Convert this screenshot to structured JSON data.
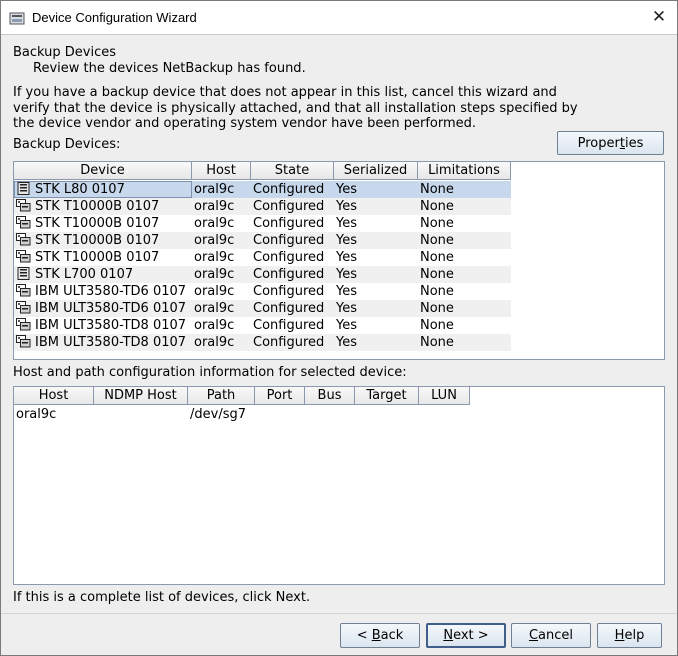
{
  "window": {
    "title": "Device Configuration Wizard",
    "close_glyph": "✕"
  },
  "header": {
    "section_title": "Backup Devices",
    "section_subtitle": "Review the devices NetBackup has found."
  },
  "instructions": {
    "line1": "If you have a backup device that does not appear in this list, cancel this wizard and",
    "line2": "verify that the device is physically attached, and that all installation steps specified by",
    "line3": "the device vendor and operating system vendor have been performed."
  },
  "devices_table": {
    "label": "Backup Devices:",
    "properties_button": {
      "pre": "Proper",
      "accel": "t",
      "post": "ies"
    },
    "columns": [
      "Device",
      "Host",
      "State",
      "Serialized",
      "Limitations"
    ],
    "rows": [
      {
        "icon": "robot-library-icon",
        "device": "STK L80 0107",
        "host": "oral9c",
        "state": "Configured",
        "serialized": "Yes",
        "limitations": "None",
        "selected": true
      },
      {
        "icon": "tape-drive-icon",
        "device": "STK T10000B 0107",
        "host": "oral9c",
        "state": "Configured",
        "serialized": "Yes",
        "limitations": "None"
      },
      {
        "icon": "tape-drive-icon",
        "device": "STK T10000B 0107",
        "host": "oral9c",
        "state": "Configured",
        "serialized": "Yes",
        "limitations": "None"
      },
      {
        "icon": "tape-drive-icon",
        "device": "STK T10000B 0107",
        "host": "oral9c",
        "state": "Configured",
        "serialized": "Yes",
        "limitations": "None"
      },
      {
        "icon": "tape-drive-icon",
        "device": "STK T10000B 0107",
        "host": "oral9c",
        "state": "Configured",
        "serialized": "Yes",
        "limitations": "None"
      },
      {
        "icon": "robot-library-icon",
        "device": "STK L700 0107",
        "host": "oral9c",
        "state": "Configured",
        "serialized": "Yes",
        "limitations": "None"
      },
      {
        "icon": "tape-drive-icon",
        "device": "IBM ULT3580-TD6 0107",
        "host": "oral9c",
        "state": "Configured",
        "serialized": "Yes",
        "limitations": "None"
      },
      {
        "icon": "tape-drive-icon",
        "device": "IBM ULT3580-TD6 0107",
        "host": "oral9c",
        "state": "Configured",
        "serialized": "Yes",
        "limitations": "None"
      },
      {
        "icon": "tape-drive-icon",
        "device": "IBM ULT3580-TD8 0107",
        "host": "oral9c",
        "state": "Configured",
        "serialized": "Yes",
        "limitations": "None"
      },
      {
        "icon": "tape-drive-icon",
        "device": "IBM ULT3580-TD8 0107",
        "host": "oral9c",
        "state": "Configured",
        "serialized": "Yes",
        "limitations": "None"
      }
    ]
  },
  "path_table": {
    "label": "Host and path configuration information for selected device:",
    "columns": [
      "Host",
      "NDMP Host",
      "Path",
      "Port",
      "Bus",
      "Target",
      "LUN"
    ],
    "rows": [
      {
        "host": "oral9c",
        "ndmp_host": "",
        "path": "/dev/sg7",
        "port": "",
        "bus": "",
        "target": "",
        "lun": ""
      }
    ]
  },
  "footer": {
    "hint": "If this is a complete list of devices, click Next."
  },
  "buttons": {
    "back": {
      "pre": "< ",
      "accel": "B",
      "post": "ack"
    },
    "next": {
      "pre": "",
      "accel": "N",
      "post": "ext >"
    },
    "cancel": {
      "pre": "",
      "accel": "C",
      "post": "ancel"
    },
    "help": {
      "pre": "",
      "accel": "H",
      "post": "elp"
    }
  },
  "colors": {
    "selection": "#c8d8ec",
    "stripe": "#f0f0f0",
    "grid_border": "#8a9aae"
  }
}
